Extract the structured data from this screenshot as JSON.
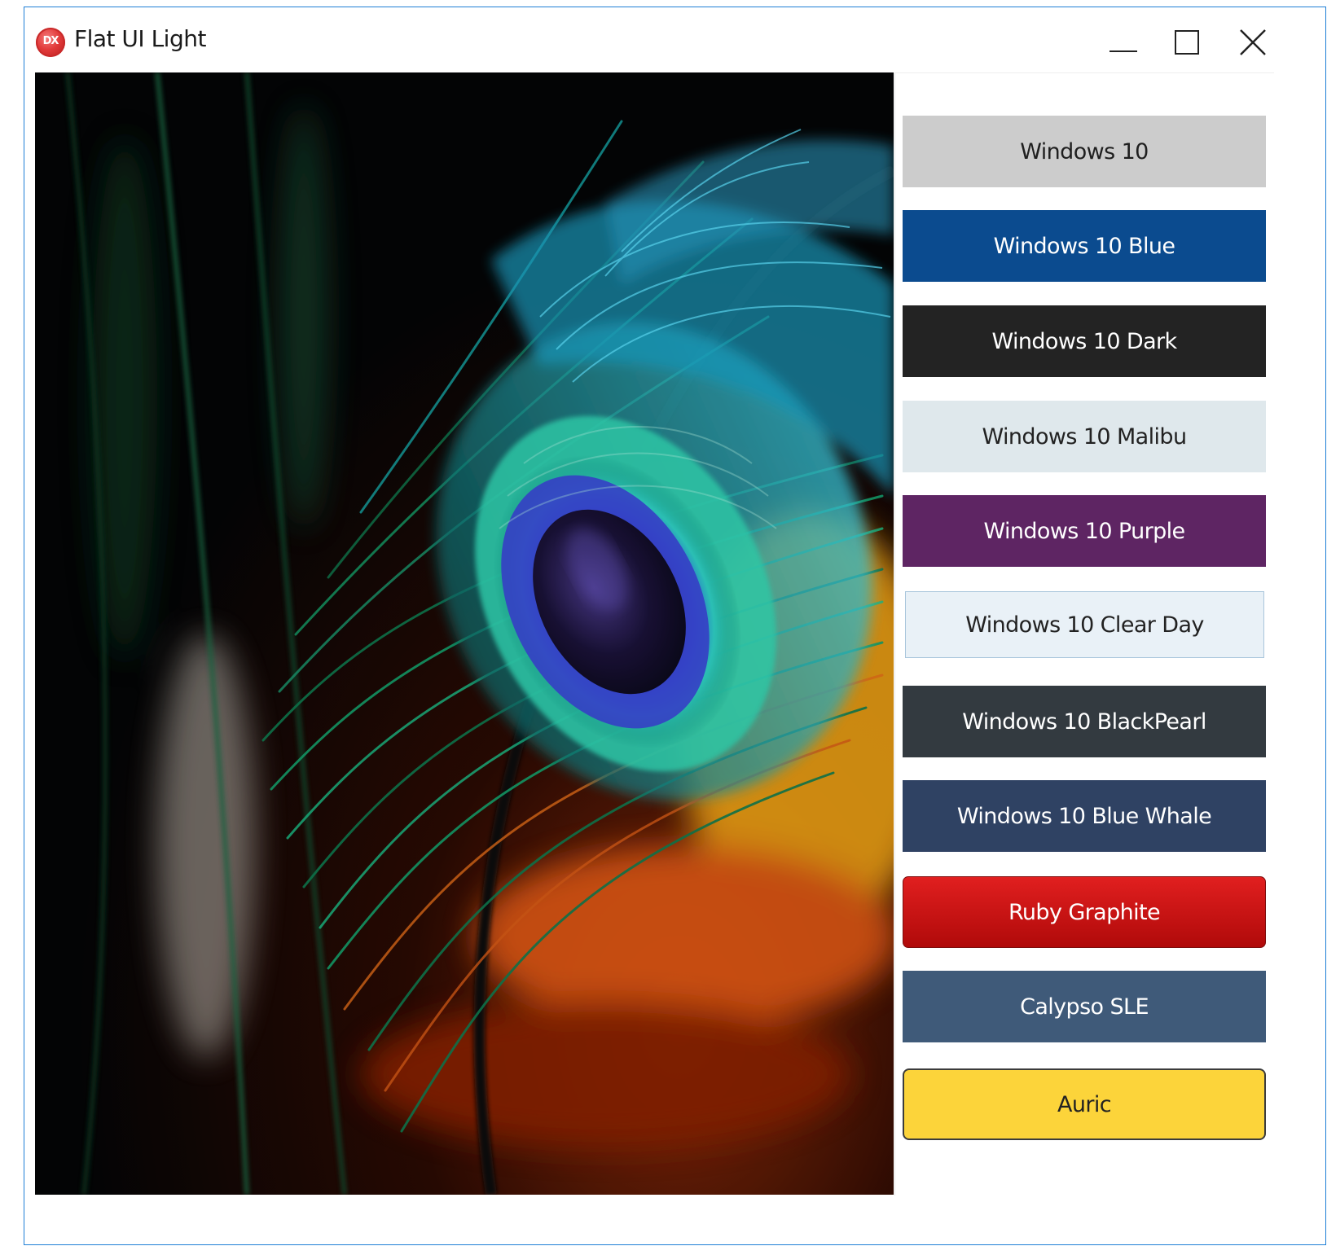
{
  "window": {
    "title": "Flat UI Light",
    "app_icon_label": "DX",
    "controls": {
      "minimize": "minimize-icon",
      "maximize": "maximize-icon",
      "close": "close-icon"
    }
  },
  "image": {
    "subject": "peacock feather photo"
  },
  "style_buttons": [
    {
      "label": "Windows 10",
      "color": "#cccccc"
    },
    {
      "label": "Windows 10 Blue",
      "color": "#0b4b8f"
    },
    {
      "label": "Windows 10 Dark",
      "color": "#232323"
    },
    {
      "label": "Windows 10 Malibu",
      "color": "#dfe8ec"
    },
    {
      "label": "Windows 10 Purple",
      "color": "#5e2563"
    },
    {
      "label": "Windows 10 Clear Day",
      "color": "#e9f1f7"
    },
    {
      "label": "Windows 10 BlackPearl",
      "color": "#333a40"
    },
    {
      "label": "Windows 10 Blue Whale",
      "color": "#2f4263"
    },
    {
      "label": "Ruby Graphite",
      "color": "#c81414"
    },
    {
      "label": "Calypso SLE",
      "color": "#3f5a79"
    },
    {
      "label": "Auric",
      "color": "#fcd43a"
    }
  ]
}
